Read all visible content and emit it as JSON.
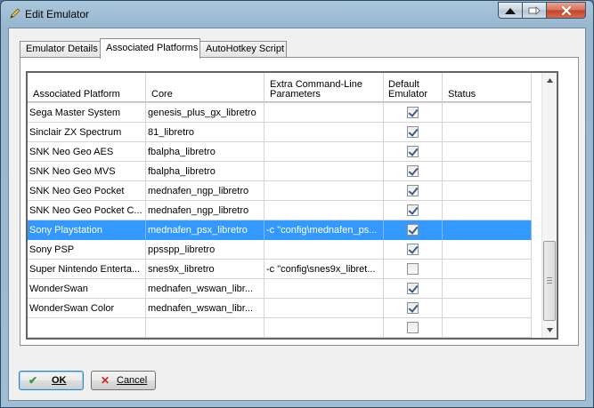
{
  "window": {
    "title": "Edit Emulator",
    "icon": "pencil-icon"
  },
  "titlebar_buttons": [
    "up-arrow-icon",
    "pin-icon",
    "close-icon"
  ],
  "tabs": [
    {
      "label": "Emulator Details",
      "active": false
    },
    {
      "label": "Associated Platforms",
      "active": true
    },
    {
      "label": "AutoHotkey Script",
      "active": false
    }
  ],
  "grid": {
    "columns": [
      "Associated Platform",
      "Core",
      "Extra Command-Line Parameters",
      "Default Emulator",
      "Status"
    ],
    "rows": [
      {
        "platform": "Sega Master System",
        "core": "genesis_plus_gx_libretro",
        "params": "",
        "default": true,
        "status": ""
      },
      {
        "platform": "Sinclair ZX Spectrum",
        "core": "81_libretro",
        "params": "",
        "default": true,
        "status": ""
      },
      {
        "platform": "SNK Neo Geo AES",
        "core": "fbalpha_libretro",
        "params": "",
        "default": true,
        "status": ""
      },
      {
        "platform": "SNK Neo Geo MVS",
        "core": "fbalpha_libretro",
        "params": "",
        "default": true,
        "status": ""
      },
      {
        "platform": "SNK Neo Geo Pocket",
        "core": "mednafen_ngp_libretro",
        "params": "",
        "default": true,
        "status": ""
      },
      {
        "platform": "SNK Neo Geo Pocket C...",
        "core": "mednafen_ngp_libretro",
        "params": "",
        "default": true,
        "status": ""
      },
      {
        "platform": "Sony Playstation",
        "core": "mednafen_psx_libretro",
        "params": "-c \"config\\mednafen_ps...",
        "default": true,
        "status": "",
        "selected": true
      },
      {
        "platform": "Sony PSP",
        "core": "ppsspp_libretro",
        "params": "",
        "default": true,
        "status": ""
      },
      {
        "platform": "Super Nintendo Enterta...",
        "core": "snes9x_libretro",
        "params": "-c \"config\\snes9x_libret...",
        "default": false,
        "status": ""
      },
      {
        "platform": "WonderSwan",
        "core": "mednafen_wswan_libr...",
        "params": "",
        "default": true,
        "status": ""
      },
      {
        "platform": "WonderSwan Color",
        "core": "mednafen_wswan_libr...",
        "params": "",
        "default": true,
        "status": ""
      },
      {
        "platform": "",
        "core": "",
        "params": "",
        "default": false,
        "status": ""
      }
    ]
  },
  "buttons": {
    "ok": {
      "label": "OK",
      "icon": "checkmark-icon"
    },
    "cancel": {
      "label": "Cancel",
      "icon": "x-icon"
    }
  }
}
